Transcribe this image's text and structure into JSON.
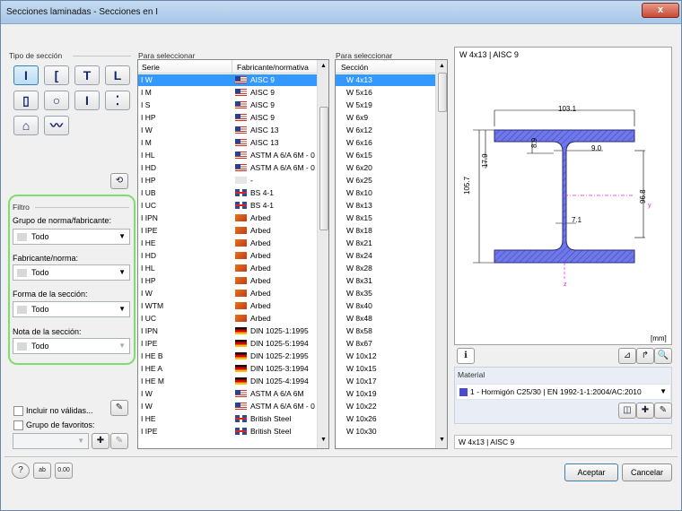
{
  "window": {
    "title": "Secciones laminadas - Secciones en I",
    "close_label": "x"
  },
  "section_type": {
    "label": "Tipo de sección",
    "buttons": [
      {
        "glyph": "I",
        "icon": "i-beam-icon"
      },
      {
        "glyph": "[",
        "icon": "channel-icon"
      },
      {
        "glyph": "T",
        "icon": "t-section-icon"
      },
      {
        "glyph": "L",
        "icon": "angle-icon"
      },
      {
        "glyph": "▯",
        "icon": "rectangular-hollow-icon"
      },
      {
        "glyph": "○",
        "icon": "circular-hollow-icon"
      },
      {
        "glyph": "Ɩ",
        "icon": "z-section-icon"
      },
      {
        "glyph": "⁚",
        "icon": "bar-icon"
      },
      {
        "glyph": "⌂",
        "icon": "rail-icon"
      },
      {
        "glyph": "〰",
        "icon": "sheet-pile-icon"
      }
    ]
  },
  "filter": {
    "label": "Filtro",
    "group_label": "Grupo de norma/fabricante:",
    "group_value": "Todo",
    "manufacturer_label": "Fabricante/norma:",
    "manufacturer_value": "Todo",
    "shape_label": "Forma de la sección:",
    "shape_value": "Todo",
    "note_label": "Nota de la sección:",
    "note_value": "Todo",
    "include_invalid_label": "Incluir no válidas...",
    "favorites_label": "Grupo de favoritos:"
  },
  "series_list": {
    "header_label": "Para seleccionar",
    "col_series": "Serie",
    "col_manufacturer": "Fabricante/normativa",
    "rows": [
      {
        "serie": "W",
        "fab": "AISC 9",
        "flag": "us"
      },
      {
        "serie": "M",
        "fab": "AISC 9",
        "flag": "us"
      },
      {
        "serie": "S",
        "fab": "AISC 9",
        "flag": "us"
      },
      {
        "serie": "HP",
        "fab": "AISC 9",
        "flag": "us"
      },
      {
        "serie": "W",
        "fab": "AISC 13",
        "flag": "us"
      },
      {
        "serie": "M",
        "fab": "AISC 13",
        "flag": "us"
      },
      {
        "serie": "HL",
        "fab": "ASTM A 6/A 6M - 0",
        "flag": "us"
      },
      {
        "serie": "HD",
        "fab": "ASTM A 6/A 6M - 0",
        "flag": "us"
      },
      {
        "serie": "HP",
        "fab": "-",
        "flag": "no"
      },
      {
        "serie": "UB",
        "fab": "BS 4-1",
        "flag": "gb"
      },
      {
        "serie": "UC",
        "fab": "BS 4-1",
        "flag": "gb"
      },
      {
        "serie": "IPN",
        "fab": "Arbed",
        "flag": "ar"
      },
      {
        "serie": "IPE",
        "fab": "Arbed",
        "flag": "ar"
      },
      {
        "serie": "HE",
        "fab": "Arbed",
        "flag": "ar"
      },
      {
        "serie": "HD",
        "fab": "Arbed",
        "flag": "ar"
      },
      {
        "serie": "HL",
        "fab": "Arbed",
        "flag": "ar"
      },
      {
        "serie": "HP",
        "fab": "Arbed",
        "flag": "ar"
      },
      {
        "serie": "W",
        "fab": "Arbed",
        "flag": "ar"
      },
      {
        "serie": "WTM",
        "fab": "Arbed",
        "flag": "ar"
      },
      {
        "serie": "UC",
        "fab": "Arbed",
        "flag": "ar"
      },
      {
        "serie": "IPN",
        "fab": "DIN 1025-1:1995",
        "flag": "de"
      },
      {
        "serie": "IPE",
        "fab": "DIN 1025-5:1994",
        "flag": "de"
      },
      {
        "serie": "HE B",
        "fab": "DIN 1025-2:1995",
        "flag": "de"
      },
      {
        "serie": "HE A",
        "fab": "DIN 1025-3:1994",
        "flag": "de"
      },
      {
        "serie": "HE M",
        "fab": "DIN 1025-4:1994",
        "flag": "de"
      },
      {
        "serie": "W",
        "fab": "ASTM A 6/A 6M",
        "flag": "us"
      },
      {
        "serie": "W",
        "fab": "ASTM A 6/A 6M - 0",
        "flag": "us"
      },
      {
        "serie": "HE",
        "fab": "British Steel",
        "flag": "gb"
      },
      {
        "serie": "IPE",
        "fab": "British Steel",
        "flag": "gb"
      }
    ]
  },
  "section_list": {
    "header_label": "Para seleccionar",
    "col_section": "Sección",
    "rows": [
      "W 4x13",
      "W 5x16",
      "W 5x19",
      "W 6x9",
      "W 6x12",
      "W 6x16",
      "W 6x15",
      "W 6x20",
      "W 6x25",
      "W 8x10",
      "W 8x13",
      "W 8x15",
      "W 8x18",
      "W 8x21",
      "W 8x24",
      "W 8x28",
      "W 8x31",
      "W 8x35",
      "W 8x40",
      "W 8x48",
      "W 8x58",
      "W 8x67",
      "W 10x12",
      "W 10x15",
      "W 10x17",
      "W 10x19",
      "W 10x22",
      "W 10x26",
      "W 10x30"
    ]
  },
  "preview": {
    "title": "W 4x13 | AISC 9",
    "dim_width": "103.1",
    "dim_height": "105.7",
    "dim_flange": "8.9",
    "dim_d1": "17.9",
    "dim_web": "7.1",
    "dim_r": "9.0",
    "dim_right": "96.8",
    "axis_y": "y",
    "axis_z": "z",
    "units": "[mm]",
    "fill_color": "#6f78e8"
  },
  "material": {
    "label": "Material",
    "value": "1 - Hormigón C25/30 | EN 1992-1-1:2004/AC:2010",
    "swatch": "#4a4acb"
  },
  "selected_text": "W 4x13 | AISC 9",
  "buttons": {
    "ok": "Aceptar",
    "cancel": "Cancelar"
  }
}
